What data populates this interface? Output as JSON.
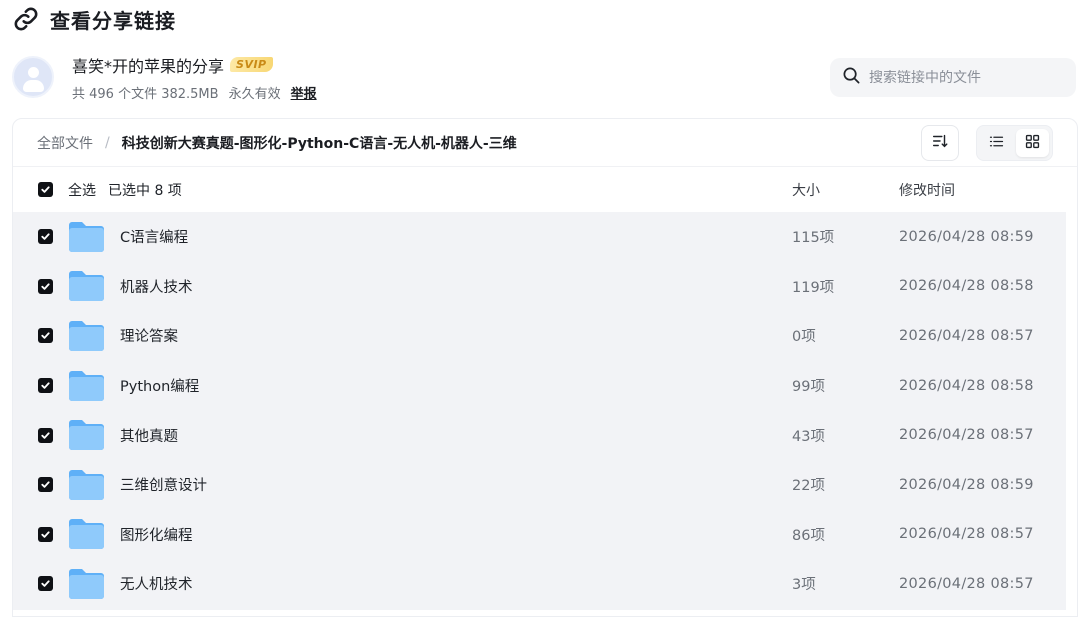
{
  "header": {
    "title": "查看分享链接"
  },
  "sharer": {
    "name": "喜笑*开的苹果的分享",
    "badge": "SVIP",
    "file_summary": "共 496 个文件 382.5MB",
    "validity": "永久有效",
    "report_label": "举报"
  },
  "search": {
    "placeholder": "搜索链接中的文件",
    "value": ""
  },
  "breadcrumb": {
    "root": "全部文件",
    "separator": "/",
    "current": "科技创新大赛真题-图形化-Python-C语言-无人机-机器人-三维"
  },
  "toolbar": {
    "sort_icon": "sort-icon",
    "list_view_icon": "list-view-icon",
    "grid_view_icon": "grid-view-icon"
  },
  "list": {
    "select_all_label": "全选",
    "selected_label": "已选中 8 项",
    "columns": {
      "size": "大小",
      "modified": "修改时间"
    },
    "rows": [
      {
        "name": "C语言编程",
        "size": "115项",
        "modified": "2026/04/28 08:59"
      },
      {
        "name": "机器人技术",
        "size": "119项",
        "modified": "2026/04/28 08:58"
      },
      {
        "name": "理论答案",
        "size": "0项",
        "modified": "2026/04/28 08:57"
      },
      {
        "name": "Python编程",
        "size": "99项",
        "modified": "2026/04/28 08:58"
      },
      {
        "name": "其他真题",
        "size": "43项",
        "modified": "2026/04/28 08:57"
      },
      {
        "name": "三维创意设计",
        "size": "22项",
        "modified": "2026/04/28 08:59"
      },
      {
        "name": "图形化编程",
        "size": "86项",
        "modified": "2026/04/28 08:57"
      },
      {
        "name": "无人机技术",
        "size": "3项",
        "modified": "2026/04/28 08:57"
      }
    ]
  },
  "colors": {
    "folder": "#4aa3f5",
    "selected_row_bg": "#f2f3f6",
    "checkbox": "#0f1115",
    "svip": "#c98a16"
  }
}
